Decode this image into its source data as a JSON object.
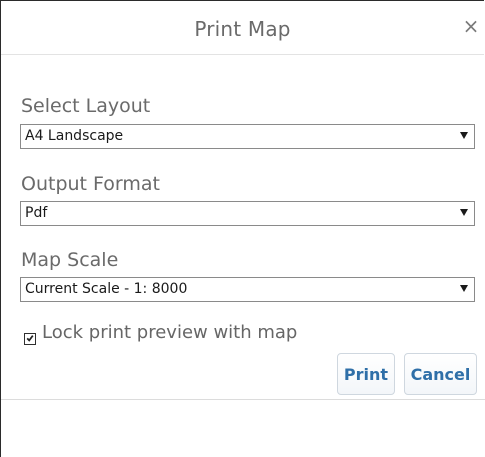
{
  "dialog": {
    "title": "Print Map",
    "close_glyph": "×",
    "close_icon": "close-icon"
  },
  "layout": {
    "label": "Select Layout",
    "selected": "A4 Landscape"
  },
  "output_format": {
    "label": "Output Format",
    "selected": "Pdf"
  },
  "map_scale": {
    "label": "Map Scale",
    "selected": "Current Scale - 1: 8000"
  },
  "lock_preview": {
    "label": "Lock print preview with map",
    "checked": true
  },
  "buttons": {
    "print": "Print",
    "cancel": "Cancel"
  },
  "colors": {
    "button_text": "#2f6fa8",
    "label_text": "#6a6a6a"
  }
}
